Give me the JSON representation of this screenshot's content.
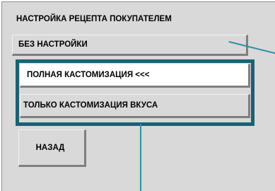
{
  "panel": {
    "title": "НАСТРОЙКА РЕЦЕПТА ПОКУПАТЕЛЕМ"
  },
  "options": {
    "no_custom_label": "БЕЗ НАСТРОЙКИ",
    "full_custom_label": "ПОЛНАЯ КАСТОМИЗАЦИЯ <<<",
    "taste_custom_label": "ТОЛЬКО КАСТОМИЗАЦИЯ ВКУСА",
    "selected": "full_custom"
  },
  "navigation": {
    "back_label": "НАЗАД"
  },
  "colors": {
    "panel_background": "#d9d9d9",
    "selected_background": "#ffffff",
    "highlight_border": "#1a6272",
    "pointer_line": "#2e8fa6"
  }
}
